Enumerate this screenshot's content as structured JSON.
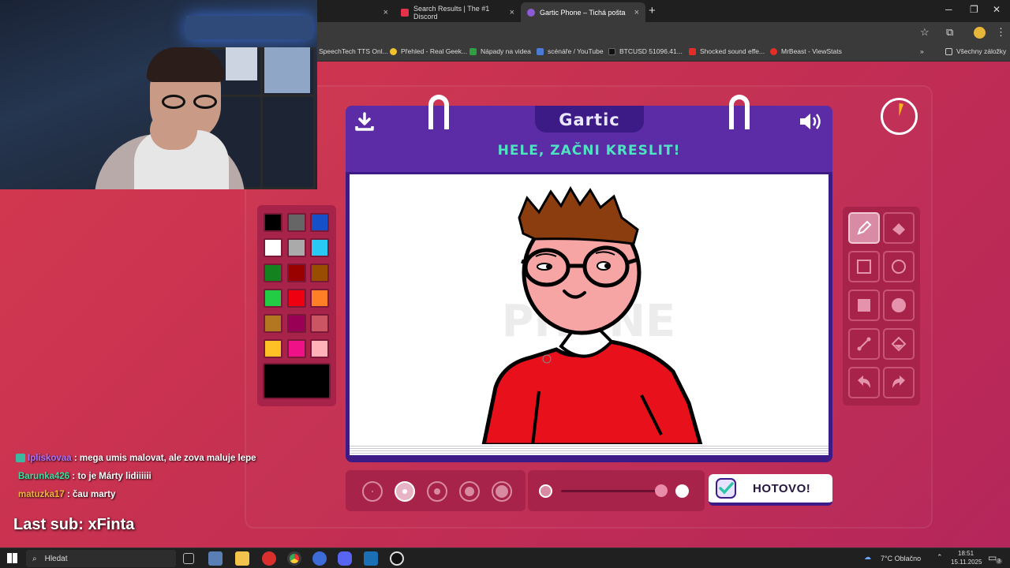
{
  "browser": {
    "tabs": [
      {
        "title": "Search Results | The #1 Discord",
        "favicon_color": "#e5324b"
      },
      {
        "title": "Gartic Phone – Tichá pošta",
        "favicon_color": "#8e5bd6"
      }
    ],
    "bookmarks": [
      {
        "label": "SpeechTech TTS Onl...",
        "color": "#777777"
      },
      {
        "label": "Přehled - Real Geek...",
        "color": "#f2c12e"
      },
      {
        "label": "Nápady na videa",
        "color": "#2ea043"
      },
      {
        "label": "scénáře / YouTube",
        "color": "#4a7bd6"
      },
      {
        "label": "BTCUSD 51096.41...",
        "color": "#111111"
      },
      {
        "label": "Shocked sound effe...",
        "color": "#e52d27"
      },
      {
        "label": "MrBeast - ViewStats",
        "color": "#e52d27"
      }
    ],
    "all_bookmarks": "Všechny záložky"
  },
  "game": {
    "logo": "Gartic",
    "prompt": "HELE, ZAČNI KRESLIT!",
    "watermark": "PHONE",
    "done_label": "HOTOVO!",
    "palette": [
      "#000000",
      "#666666",
      "#1650c8",
      "#ffffff",
      "#aaaaaa",
      "#29c9f5",
      "#14821e",
      "#990000",
      "#994d00",
      "#22cc44",
      "#ee0011",
      "#ff7f27",
      "#b27720",
      "#990055",
      "#cc5563",
      "#ffc125",
      "#ee1188",
      "#ffb3b8"
    ],
    "current_color": "#000000",
    "tools": [
      "pencil-icon",
      "eraser-icon",
      "square-outline-icon",
      "circle-outline-icon",
      "square-filled-icon",
      "circle-filled-icon",
      "line-icon",
      "fill-bucket-icon",
      "undo-icon",
      "redo-icon"
    ],
    "selected_tool": "pencil-icon",
    "brush_sizes_count": 5,
    "selected_size_index": 1,
    "opacity_value": 1.0
  },
  "chat": [
    {
      "user": "Ipliskovaa",
      "user_color": "#a874ff",
      "message": ": mega umis malovat, ale zova maluje lepe"
    },
    {
      "user": "Barunka426",
      "user_color": "#39e0a0",
      "message": ": to je Márty lidiiiiii"
    },
    {
      "user": "matuzka17",
      "user_color": "#f0b43c",
      "message": ": čau marty"
    }
  ],
  "last_sub": "Last sub: xFinta",
  "taskbar": {
    "search_placeholder": "Hledat",
    "weather": "7°C  Oblačno",
    "time": "18:51",
    "date": "15.11.2025",
    "notifications": "3"
  }
}
